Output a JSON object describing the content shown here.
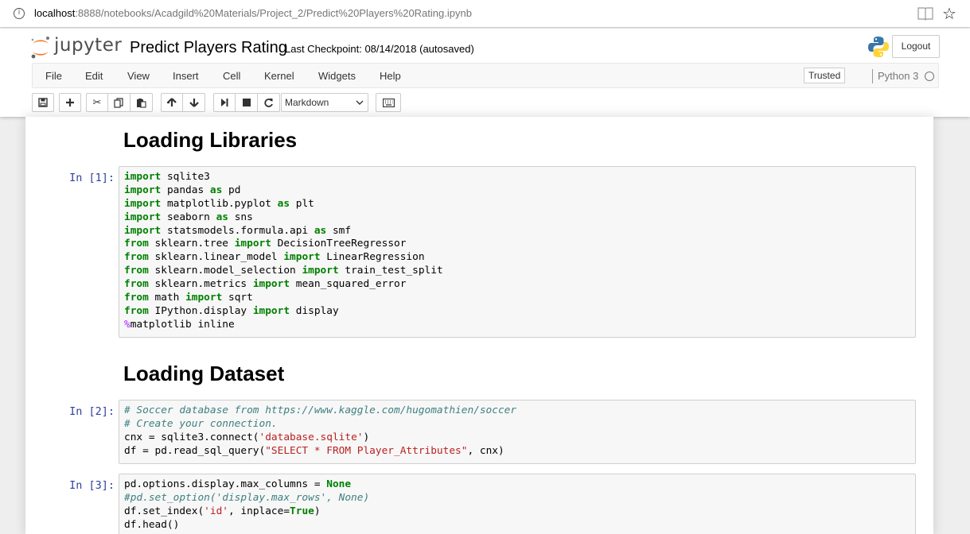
{
  "browser": {
    "url_host": "localhost",
    "url_path": ":8888/notebooks/Acadgild%20Materials/Project_2/Predict%20Players%20Rating.ipynb"
  },
  "header": {
    "logo_text": "jupyter",
    "notebook_title": "Predict Players Rating",
    "checkpoint": "Last Checkpoint: 08/14/2018 (autosaved)",
    "logout_label": "Logout"
  },
  "menubar": {
    "items": [
      "File",
      "Edit",
      "View",
      "Insert",
      "Cell",
      "Kernel",
      "Widgets",
      "Help"
    ],
    "trusted_label": "Trusted",
    "kernel_name": "Python 3"
  },
  "toolbar": {
    "cell_type": "Markdown",
    "buttons": [
      "save-icon",
      "plus-icon",
      "scissors-icon",
      "copy-icon",
      "paste-icon",
      "arrow-up-icon",
      "arrow-down-icon",
      "step-forward-icon",
      "stop-icon",
      "refresh-icon",
      "keyboard-icon"
    ]
  },
  "cells": {
    "h1": "Loading Libraries",
    "c1_prompt": "In [1]:",
    "c1_lines": [
      [
        [
          "kw",
          "import"
        ],
        [
          "",
          "sqlite3"
        ]
      ],
      [
        [
          "kw",
          "import"
        ],
        [
          "",
          "pandas "
        ],
        [
          "kw",
          "as"
        ],
        [
          "",
          "pd"
        ]
      ],
      [
        [
          "kw",
          "import"
        ],
        [
          "",
          "matplotlib.pyplot "
        ],
        [
          "kw",
          "as"
        ],
        [
          "",
          "plt"
        ]
      ],
      [
        [
          "kw",
          "import"
        ],
        [
          "",
          "seaborn "
        ],
        [
          "kw",
          "as"
        ],
        [
          "",
          "sns"
        ]
      ],
      [
        [
          "kw",
          "import"
        ],
        [
          "",
          "statsmodels.formula.api "
        ],
        [
          "kw",
          "as"
        ],
        [
          "",
          "smf"
        ]
      ],
      [
        [
          "kw",
          "from"
        ],
        [
          "",
          "sklearn.tree "
        ],
        [
          "kw",
          "import"
        ],
        [
          "",
          "DecisionTreeRegressor"
        ]
      ],
      [
        [
          "kw",
          "from"
        ],
        [
          "",
          "sklearn.linear_model "
        ],
        [
          "kw",
          "import"
        ],
        [
          "",
          "LinearRegression"
        ]
      ],
      [
        [
          "kw",
          "from"
        ],
        [
          "",
          "sklearn.model_selection "
        ],
        [
          "kw",
          "import"
        ],
        [
          "",
          "train_test_split"
        ]
      ],
      [
        [
          "kw",
          "from"
        ],
        [
          "",
          "sklearn.metrics "
        ],
        [
          "kw",
          "import"
        ],
        [
          "",
          "mean_squared_error"
        ]
      ],
      [
        [
          "kw",
          "from"
        ],
        [
          "",
          "math "
        ],
        [
          "kw",
          "import"
        ],
        [
          "",
          "sqrt"
        ]
      ],
      [
        [
          "kw",
          "from"
        ],
        [
          "",
          "IPython.display "
        ],
        [
          "kw",
          "import"
        ],
        [
          "",
          "display"
        ]
      ],
      [
        [
          "mg",
          "%"
        ],
        [
          "",
          "matplotlib inline"
        ]
      ]
    ],
    "h2": "Loading Dataset",
    "c2_prompt": "In [2]:",
    "c2_lines": [
      [
        [
          "cm",
          "# Soccer database from https://www.kaggle.com/hugomathien/soccer"
        ]
      ],
      [
        [
          "cm",
          "# Create your connection."
        ]
      ],
      [
        [
          "",
          "cnx = sqlite3.connect("
        ],
        [
          "str",
          "'database.sqlite'"
        ],
        [
          "",
          ")"
        ]
      ],
      [
        [
          "",
          "df = pd.read_sql_query("
        ],
        [
          "str",
          "\"SELECT * FROM Player_Attributes\""
        ],
        [
          "",
          ", cnx)"
        ]
      ]
    ],
    "c3_prompt": "In [3]:",
    "c3_lines": [
      [
        [
          "",
          "pd.options.display.max_columns = "
        ],
        [
          "cst",
          "None"
        ]
      ],
      [
        [
          "cm",
          "#pd.set_option('display.max_rows', None)"
        ]
      ],
      [
        [
          "",
          "df.set_index("
        ],
        [
          "str",
          "'id'"
        ],
        [
          "",
          ", inplace="
        ],
        [
          "cst",
          "True"
        ],
        [
          "",
          ")"
        ]
      ],
      [
        [
          "",
          "df.head()"
        ]
      ]
    ]
  }
}
